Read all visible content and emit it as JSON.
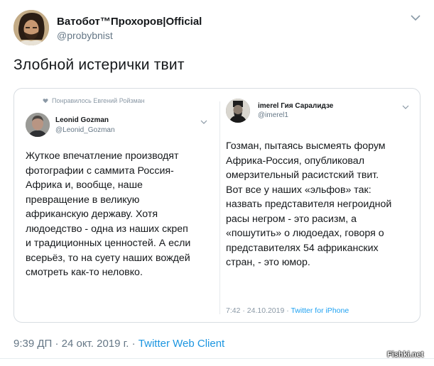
{
  "author": {
    "display_name": "Ватобот™Прохоров|Official",
    "handle": "@probybnist"
  },
  "tweet": {
    "text": "Злобной истерички твит",
    "timestamp": "9:39 ДП · 24 окт. 2019 г.",
    "separator": " · ",
    "client": "Twitter Web Client"
  },
  "screenshot": {
    "liked_by": "Понравилось Евгений Ройзман",
    "left_tweet": {
      "name": "Leonid Gozman",
      "handle": "@Leonid_Gozman",
      "lines": [
        "Жуткое впечатление производят",
        "фотографии с саммита Россия-",
        "Африка и, вообще, наше",
        "превращение в великую",
        "африканскую державу. Хотя",
        "людоедство - одна из наших скреп",
        "и традиционных ценностей. А если",
        "всерьёз, то на суету наших вождей",
        "смотреть как-то неловко."
      ]
    },
    "right_tweet": {
      "name": "imerel Гия Саралидзе",
      "handle": "@imerel1",
      "lines": [
        "Гозман, пытаясь высмеять форум",
        "Африка-Россия, опубликовал",
        "омерзительный расистский твит.",
        "Вот все у наших «эльфов» так:",
        "назвать представителя негроидной",
        "расы негром - это расизм, а",
        "«пошутить» о людоедах, говоря о",
        "представителях 54 африканских",
        "стран, - это юмор."
      ],
      "time": "7:42 · 24.10.2019 · ",
      "client": "Twitter for iPhone"
    }
  },
  "watermark": "Fishki.net",
  "icons": {
    "caret": "chevron-down-icon",
    "heart": "heart-icon"
  },
  "colors": {
    "link": "#1b95e0",
    "muted": "#657786",
    "border": "#d8dde2"
  }
}
